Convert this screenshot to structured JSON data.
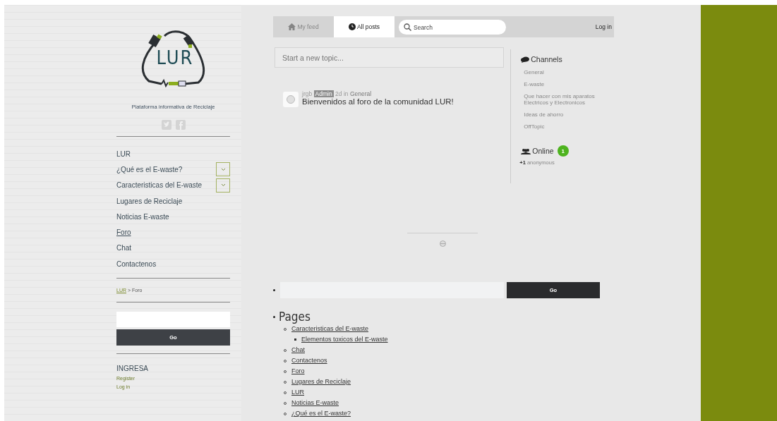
{
  "site": {
    "logo_text": "LUR",
    "tagline": "Plataforma informativa de Reciclaje"
  },
  "menu": [
    {
      "label": "LUR",
      "selected": false,
      "expandable": false
    },
    {
      "label": "¿Qué es el E-waste?",
      "selected": false,
      "expandable": true
    },
    {
      "label": "Caracteristicas del E-waste",
      "selected": false,
      "expandable": true
    },
    {
      "label": "Lugares de Reciclaje",
      "selected": false,
      "expandable": false
    },
    {
      "label": "Noticias E-waste",
      "selected": false,
      "expandable": false
    },
    {
      "label": "Foro",
      "selected": true,
      "expandable": false
    },
    {
      "label": "Chat",
      "selected": false,
      "expandable": false
    },
    {
      "label": "Contactenos",
      "selected": false,
      "expandable": false
    }
  ],
  "breadcrumb": {
    "link": "LUR",
    "separator": ">",
    "current": "Foro"
  },
  "sidebar_search": {
    "button": "Go"
  },
  "login_section": {
    "title": "INGRESA",
    "links": [
      "Register",
      "Log in"
    ]
  },
  "forum": {
    "tabs": [
      {
        "label": "My feed",
        "selected": false
      },
      {
        "label": "All posts",
        "selected": true
      }
    ],
    "search": {
      "placeholder": "Search"
    },
    "login": "Log in",
    "new_topic": {
      "placeholder": "Start a new topic..."
    },
    "posts": [
      {
        "author": "jrgb",
        "badge": "Admin",
        "age": "2d",
        "in": "in",
        "channel": "General",
        "title": "Bienvenidos al foro de la comunidad LUR!"
      }
    ],
    "channels": {
      "title": "Channels",
      "items": [
        "General",
        "E-waste",
        "Que hacer con mis aparatos Electricos y Electronicos",
        "Ideas de ahorro",
        "OffTopic"
      ]
    },
    "online": {
      "title": "Online",
      "count": "1",
      "anonymous_count": "+1",
      "anonymous_label": "anonymous"
    }
  },
  "main_search": {
    "button": "Go"
  },
  "pages": {
    "title": "Pages",
    "items": [
      {
        "label": "Caracteristicas del E-waste",
        "children": [
          {
            "label": "Elementos toxicos del E-waste"
          }
        ]
      },
      {
        "label": "Chat"
      },
      {
        "label": "Contactenos"
      },
      {
        "label": "Foro"
      },
      {
        "label": "Lugares de Reciclaje"
      },
      {
        "label": "LUR"
      },
      {
        "label": "Noticias E-waste"
      },
      {
        "label": "¿Qué es el E-waste?"
      }
    ]
  }
}
